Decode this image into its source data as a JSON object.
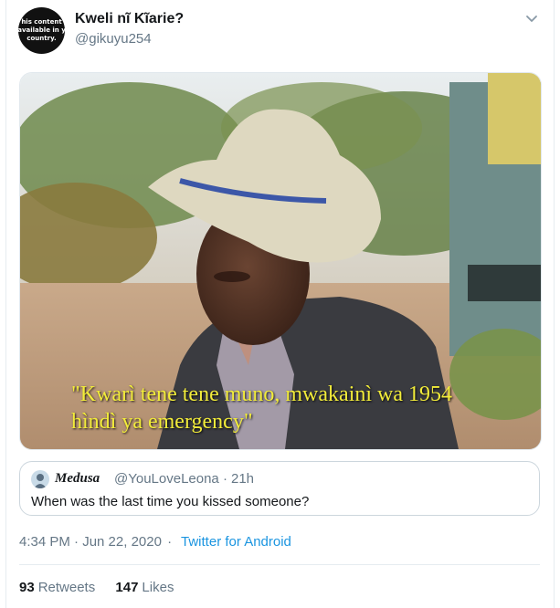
{
  "author": {
    "name": "Kweli nĩ Kĩarie?",
    "handle": "@gikuyu254",
    "avatar_lines": [
      "his content",
      "available in y",
      "country."
    ]
  },
  "media": {
    "caption_line1": "\"Kwarì tene tene muno, mwakainì wa 1954",
    "caption_line2": "hìndì ya emergency\"",
    "caption_color": "#f2ec3a"
  },
  "quoted": {
    "name": "Medusa",
    "handle": "@YouLoveLeona",
    "separator": "·",
    "time": "21h",
    "text": "When was the last time you kissed someone?"
  },
  "meta": {
    "timestamp": "4:34 PM · Jun 22, 2020",
    "separator": "·",
    "source": "Twitter for Android",
    "source_color": "#1b95e0"
  },
  "stats": {
    "retweets_count": "93",
    "retweets_label": "Retweets",
    "likes_count": "147",
    "likes_label": "Likes"
  },
  "icons": {
    "caret": "chevron-down-icon"
  }
}
